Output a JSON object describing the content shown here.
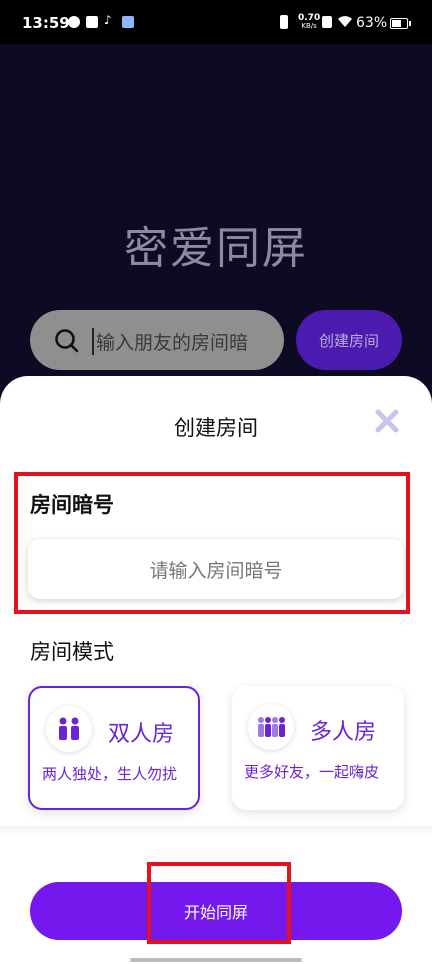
{
  "status_bar": {
    "time": "13:59",
    "net_speed_value": "0.70",
    "net_speed_unit": "KB/s",
    "battery_percent": "63%",
    "battery_level": 0.63
  },
  "background": {
    "app_title": "密爱同屏",
    "search_text": "输入朋友的房间暗",
    "create_room_label": "创建房间"
  },
  "sheet": {
    "title": "创建房间",
    "room_code_label": "房间暗号",
    "room_code_placeholder": "请输入房间暗号",
    "room_mode_label": "房间模式",
    "modes": [
      {
        "name": "双人房",
        "description": "两人独处，生人勿扰",
        "selected": true
      },
      {
        "name": "多人房",
        "description": "更多好友，一起嗨皮",
        "selected": false
      }
    ],
    "start_button_label": "开始同屏"
  },
  "colors": {
    "accent": "#7418ee",
    "accent_text": "#6a24d6",
    "highlight": "#e6111f",
    "overlay_bg": "#0d0a24"
  }
}
